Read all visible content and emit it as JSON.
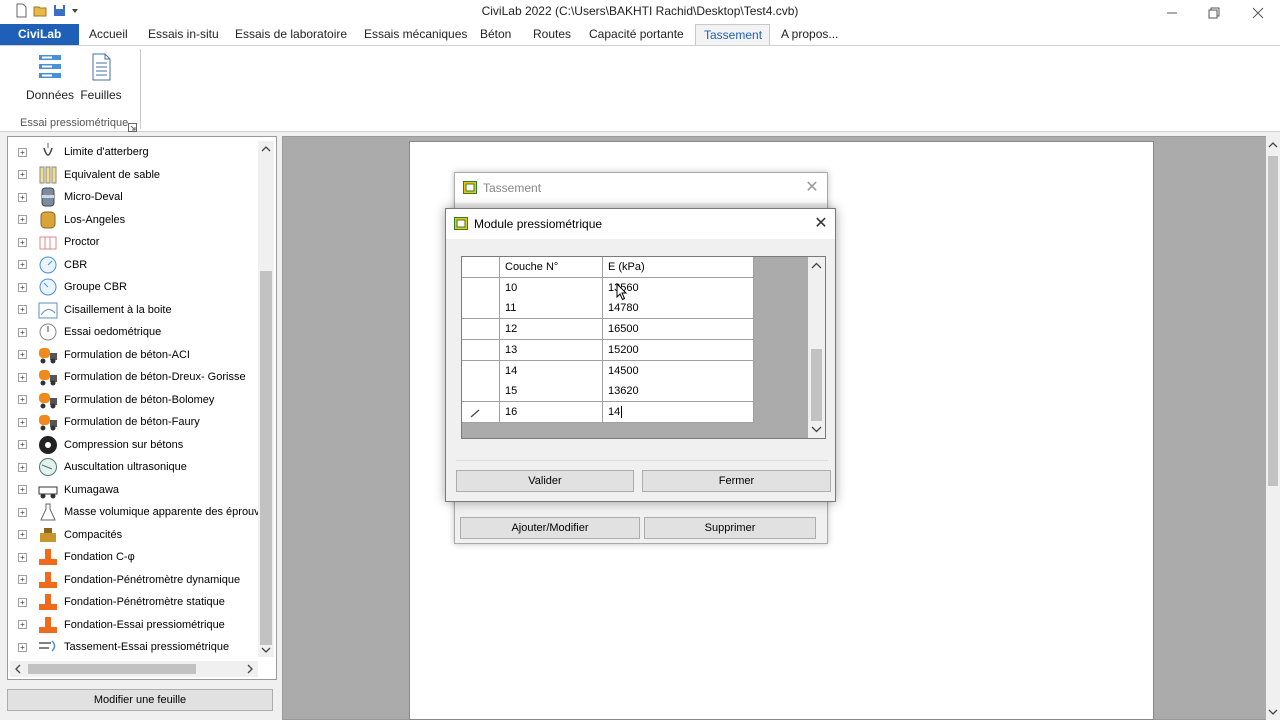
{
  "window": {
    "title": "CiviLab 2022 (C:\\Users\\BAKHTI Rachid\\Desktop\\Test4.cvb)"
  },
  "tabs": [
    {
      "label": "CiviLab"
    },
    {
      "label": "Accueil"
    },
    {
      "label": "Essais in-situ"
    },
    {
      "label": "Essais de laboratoire"
    },
    {
      "label": "Essais mécaniques"
    },
    {
      "label": "Béton"
    },
    {
      "label": "Routes"
    },
    {
      "label": "Capacité portante"
    },
    {
      "label": "Tassement"
    },
    {
      "label": "A propos..."
    }
  ],
  "ribbon": {
    "buttons": [
      {
        "label": "Données"
      },
      {
        "label": "Feuilles"
      }
    ],
    "group_label": "Essai pressiométrique"
  },
  "tree": {
    "items": [
      {
        "label": "Limite d'atterberg",
        "icon": "atterberg-icon"
      },
      {
        "label": "Equivalent de sable",
        "icon": "sand-equivalent-icon"
      },
      {
        "label": "Micro-Deval",
        "icon": "micro-deval-icon"
      },
      {
        "label": "Los-Angeles",
        "icon": "los-angeles-icon"
      },
      {
        "label": "Proctor",
        "icon": "proctor-icon"
      },
      {
        "label": "CBR",
        "icon": "cbr-gauge-icon"
      },
      {
        "label": "Groupe CBR",
        "icon": "cbr-group-icon"
      },
      {
        "label": "Cisaillement à la boite",
        "icon": "shear-box-icon"
      },
      {
        "label": "Essai oedométrique",
        "icon": "oedometer-icon"
      },
      {
        "label": "Formulation de béton-ACI",
        "icon": "concrete-truck-icon"
      },
      {
        "label": "Formulation de béton-Dreux- Gorisse",
        "icon": "concrete-truck-icon"
      },
      {
        "label": "Formulation de béton-Bolomey",
        "icon": "concrete-truck-icon"
      },
      {
        "label": "Formulation de béton-Faury",
        "icon": "concrete-truck-icon"
      },
      {
        "label": "Compression sur bétons",
        "icon": "compression-gauge-icon"
      },
      {
        "label": "Auscultation ultrasonique",
        "icon": "ultrasonic-gauge-icon"
      },
      {
        "label": "Kumagawa",
        "icon": "kumagawa-icon"
      },
      {
        "label": "Masse volumique apparente des éprouvettes",
        "icon": "flask-icon"
      },
      {
        "label": "Compacités",
        "icon": "compaction-icon"
      },
      {
        "label": "Fondation C-φ",
        "icon": "foundation-icon"
      },
      {
        "label": "Fondation-Pénétromètre dynamique",
        "icon": "foundation-icon"
      },
      {
        "label": "Fondation-Pénétromètre statique",
        "icon": "foundation-icon"
      },
      {
        "label": "Fondation-Essai pressiométrique",
        "icon": "foundation-icon"
      },
      {
        "label": "Tassement-Essai pressiométrique",
        "icon": "settlement-icon"
      }
    ]
  },
  "left_button": "Modifier une feuille",
  "bg_dialog": {
    "title": "Tassement",
    "buttons": {
      "add": "Ajouter/Modifier",
      "delete": "Supprimer"
    }
  },
  "dialog": {
    "title": "Module pressiométrique",
    "columns": [
      "Couche N°",
      "E (kPa)"
    ],
    "rows": [
      {
        "couche": "10",
        "e": "13560"
      },
      {
        "couche": "11",
        "e": "14780"
      },
      {
        "couche": "12",
        "e": "16500"
      },
      {
        "couche": "13",
        "e": "15200"
      },
      {
        "couche": "14",
        "e": "14500"
      },
      {
        "couche": "15",
        "e": "13620"
      },
      {
        "couche": "16",
        "e": "14"
      }
    ],
    "buttons": {
      "validate": "Valider",
      "close": "Fermer"
    }
  },
  "colors": {
    "accent": "#1e5fb8",
    "workarea": "#ababab"
  }
}
